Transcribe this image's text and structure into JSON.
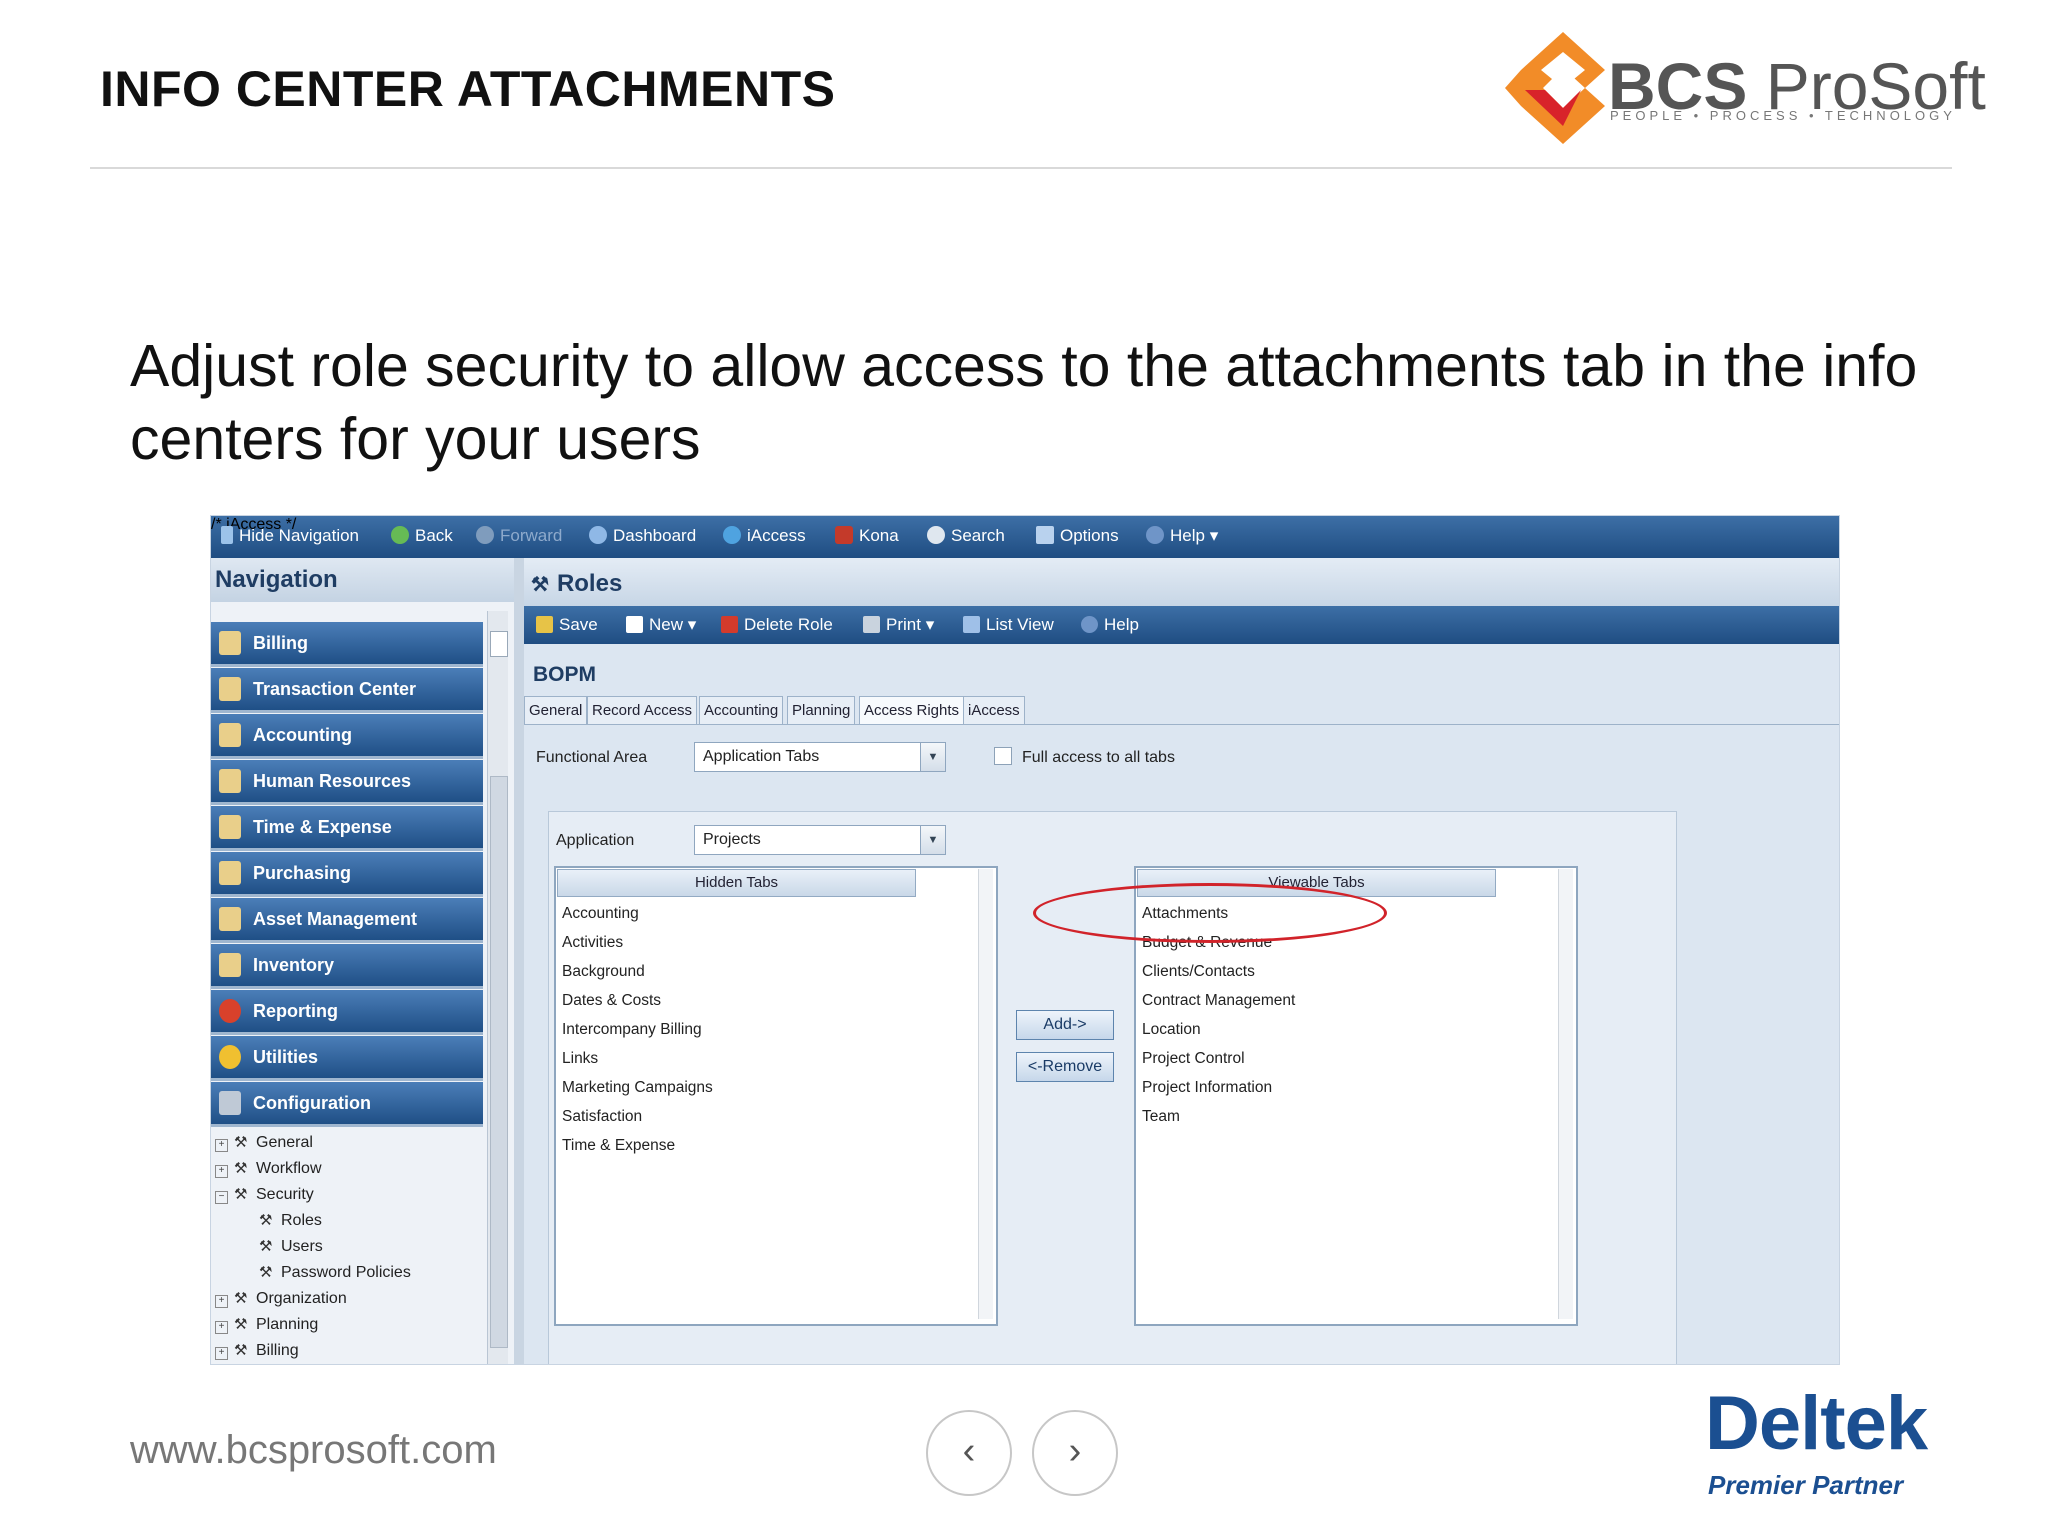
{
  "slide": {
    "title": "INFO CENTER ATTACHMENTS",
    "subtitle": "Adjust role security to allow access to the attachments tab in the info centers for your users",
    "website": "www.bcsprosoft.com",
    "prev_label": "‹",
    "next_label": "›"
  },
  "logo": {
    "brand_bold": "BCS",
    "brand_rest": " ProSoft",
    "tagline": "PEOPLE • PROCESS • TECHNOLOGY",
    "colors": {
      "orange": "#f28c28",
      "red": "#d8232a"
    }
  },
  "partner": {
    "name": "Deltek",
    "tagline": "Premier Partner"
  },
  "app": {
    "topbar": {
      "hide_navigation": "Hide Navigation",
      "back": "Back",
      "forward": "Forward",
      "dashboard": "Dashboard",
      "iaccess": "iAccess",
      "kona": "Kona",
      "search": "Search",
      "options": "Options",
      "help": "Help"
    },
    "navigation": {
      "title": "Navigation",
      "buttons": [
        "Billing",
        "Transaction Center",
        "Accounting",
        "Human Resources",
        "Time & Expense",
        "Purchasing",
        "Asset Management",
        "Inventory",
        "Reporting",
        "Utilities",
        "Configuration"
      ],
      "tree": [
        "General",
        "Workflow",
        "Security",
        "Roles",
        "Users",
        "Password Policies",
        "Organization",
        "Planning",
        "Billing"
      ]
    },
    "roles": {
      "title": "Roles",
      "toolbar": {
        "save": "Save",
        "new": "New",
        "delete_role": "Delete Role",
        "print": "Print",
        "list_view": "List View",
        "help": "Help"
      },
      "role_name": "BOPM",
      "tabs": [
        "General",
        "Record Access",
        "Accounting",
        "Planning",
        "Access Rights",
        "iAccess"
      ],
      "active_tab": "Access Rights",
      "functional_area_label": "Functional Area",
      "functional_area_value": "Application Tabs",
      "full_access_label": "Full access to all tabs",
      "application_label": "Application",
      "application_value": "Projects",
      "hidden_tabs_header": "Hidden Tabs",
      "hidden_tabs": [
        "Accounting",
        "Activities",
        "Background",
        "Dates & Costs",
        "Intercompany Billing",
        "Links",
        "Marketing Campaigns",
        "Satisfaction",
        "Time & Expense"
      ],
      "viewable_tabs_header": "Viewable Tabs",
      "viewable_tabs": [
        "Attachments",
        "Budget & Revenue",
        "Clients/Contacts",
        "Contract Management",
        "Location",
        "Project Control",
        "Project Information",
        "Team"
      ],
      "add_button": "Add->",
      "remove_button": "<-Remove",
      "highlight_color": "#d1232a"
    }
  }
}
